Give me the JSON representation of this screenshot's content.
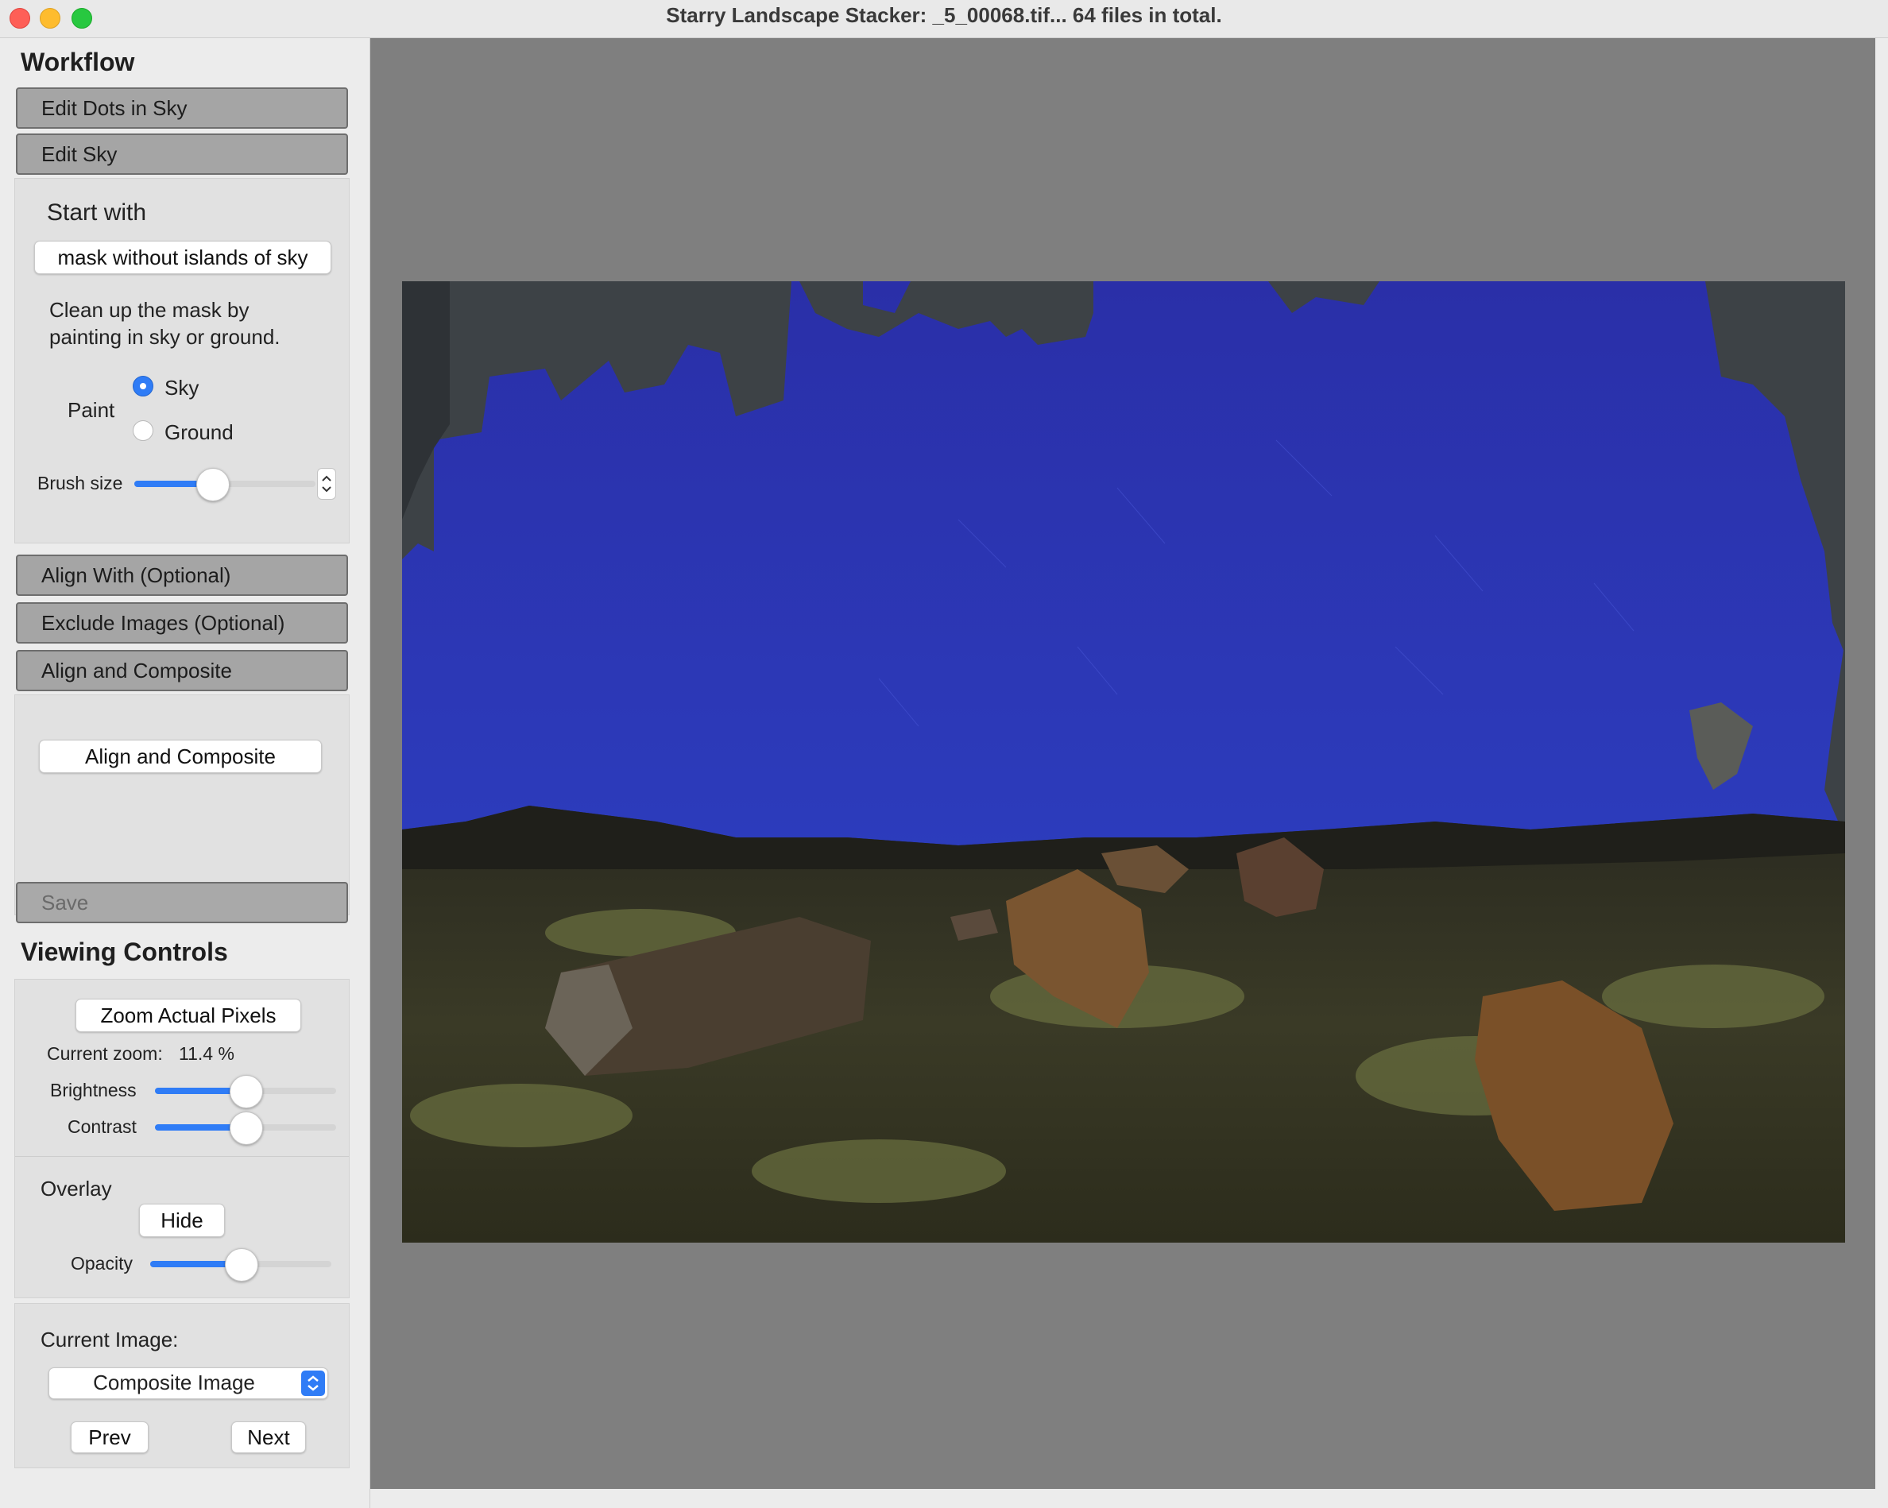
{
  "window": {
    "title": "Starry Landscape Stacker: _5_00068.tif...  64 files in total."
  },
  "workflow": {
    "title": "Workflow",
    "steps": [
      {
        "label": "Edit Dots in Sky"
      },
      {
        "label": "Edit Sky"
      },
      {
        "label": "Align With (Optional)"
      },
      {
        "label": "Exclude Images (Optional)"
      },
      {
        "label": "Align and Composite"
      }
    ],
    "edit_sky": {
      "start_with_label": "Start with",
      "start_with_value": "mask without islands of sky",
      "instructions_line1": "Clean up the mask by",
      "instructions_line2": "painting in sky or ground.",
      "paint_label": "Paint",
      "paint_options": [
        "Sky",
        "Ground"
      ],
      "paint_selected": "Sky",
      "brush_size_label": "Brush size",
      "brush_size": 0.43
    },
    "composite_button": "Align and Composite",
    "save_label": "Save"
  },
  "viewing": {
    "title": "Viewing Controls",
    "zoom_button": "Zoom Actual Pixels",
    "current_zoom_label": "Current zoom:",
    "current_zoom_value": "11.4 %",
    "brightness_label": "Brightness",
    "brightness": 0.5,
    "contrast_label": "Contrast",
    "contrast": 0.5,
    "overlay_label": "Overlay",
    "hide_button": "Hide",
    "opacity_label": "Opacity",
    "opacity": 0.5,
    "current_image_label": "Current Image:",
    "current_image_value": "Composite Image",
    "prev_label": "Prev",
    "next_label": "Next"
  },
  "colors": {
    "accent": "#2f7cf6",
    "sky": "#2a33b8",
    "viewer_bg": "#7f7f7f"
  },
  "icons": {
    "close": "close-traffic-light",
    "minimize": "minimize-traffic-light",
    "zoom": "zoom-traffic-light",
    "select": "updown-chevron-icon"
  }
}
